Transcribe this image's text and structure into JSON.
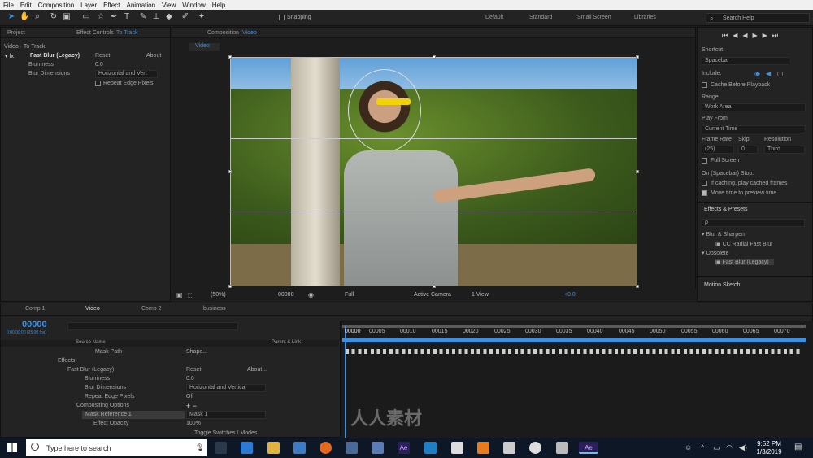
{
  "menu": [
    "File",
    "Edit",
    "Composition",
    "Layer",
    "Effect",
    "Animation",
    "View",
    "Window",
    "Help"
  ],
  "toolbar": {
    "snapping": "Snapping",
    "workspaces": [
      "Default",
      "Standard",
      "Small Screen",
      "Libraries"
    ],
    "search_placeholder": "Search Help"
  },
  "left_panel": {
    "tabs": [
      "Project",
      "Effect Controls",
      "To Track"
    ],
    "breadcrumb": "Video · To Track",
    "effect_name": "Fast Blur (Legacy)",
    "reset": "Reset",
    "about": "About",
    "rows": [
      {
        "label": "Blurriness",
        "value": "0.0"
      },
      {
        "label": "Blur Dimensions",
        "value": "Horizontal and Vert"
      },
      {
        "label": "Repeat Edge Pixels",
        "value": ""
      }
    ]
  },
  "comp_panel": {
    "tab_label": "Composition",
    "tab_name": "Video",
    "subtab": "Video",
    "controls": {
      "zoom": "(50%)",
      "time": "00000",
      "resolution": "Full",
      "camera": "Active Camera",
      "views": "1 View",
      "exposure": "+0.0"
    }
  },
  "right_panel": {
    "shortcut_label": "Shortcut",
    "shortcut_value": "Spacebar",
    "include_label": "Include:",
    "cache_before_playback": "Cache Before Playback",
    "range_label": "Range",
    "range_value": "Work Area",
    "play_from_label": "Play From",
    "play_from_value": "Current Time",
    "frame_rate_label": "Frame Rate",
    "skip_label": "Skip",
    "resolution_label": "Resolution",
    "frame_rate_value": "(25)",
    "skip_value": "0",
    "resolution_value": "Third",
    "full_screen": "Full Screen",
    "on_stop_label": "On (Spacebar) Stop:",
    "if_caching": "If caching, play cached frames",
    "move_time": "Move time to preview time",
    "effects_presets": "Effects & Presets",
    "search_value": "ρ",
    "tree": [
      {
        "label": "Blur & Sharpen",
        "level": 0
      },
      {
        "label": "CC Radial Fast Blur",
        "level": 1
      },
      {
        "label": "Obsolete",
        "level": 0
      },
      {
        "label": "Fast Blur (Legacy)",
        "level": 1
      }
    ],
    "motion_sketch": "Motion Sketch"
  },
  "timeline": {
    "tabs": [
      "Comp 1",
      "Video",
      "Comp 2",
      "business"
    ],
    "timecode": "00000",
    "timecode_sub": "0:00:00:00 (25.00 fps)",
    "col_source": "Source Name",
    "col_parent": "Parent & Link",
    "ruler": [
      "00000",
      "00005",
      "00010",
      "00015",
      "00020",
      "00025",
      "00030",
      "00035",
      "00040",
      "00045",
      "00050",
      "00055",
      "00060",
      "00065",
      "00070"
    ],
    "layers": [
      {
        "label": "Mask Path",
        "value": "Shape..."
      },
      {
        "label": "Effects",
        "value": ""
      },
      {
        "label": "Fast Blur (Legacy)",
        "value": "Reset",
        "value2": "About..."
      },
      {
        "label": "Blurriness",
        "value": "0.0"
      },
      {
        "label": "Blur Dimensions",
        "value": "Horizontal and Vertical"
      },
      {
        "label": "Repeat Edge Pixels",
        "value": "Off"
      },
      {
        "label": "Compositing Options",
        "value": "+ −"
      },
      {
        "label": "Mask Reference 1",
        "value": "Mask 1"
      },
      {
        "label": "Effect Opacity",
        "value": "100",
        "unit": "%"
      }
    ],
    "toggle": "Toggle Switches / Modes"
  },
  "taskbar": {
    "search": "Type here to search",
    "time": "9:52 PM",
    "date": "1/3/2019"
  },
  "watermark": "人人素材"
}
